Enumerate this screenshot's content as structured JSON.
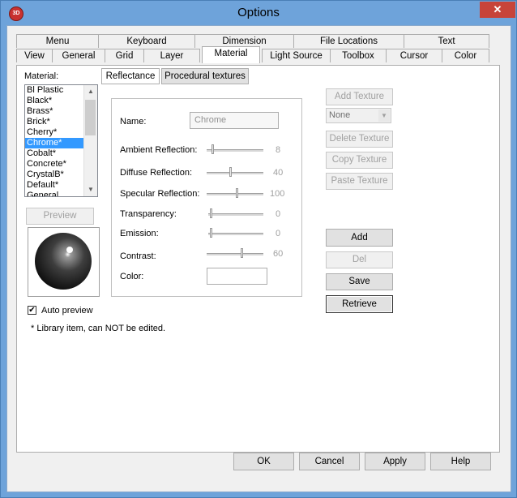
{
  "window": {
    "title": "Options",
    "close_glyph": "✕",
    "app_icon_text": "3D"
  },
  "tabs_row1": [
    "Menu",
    "Keyboard",
    "Dimension",
    "File Locations",
    "Text"
  ],
  "tabs_row2": [
    "View",
    "General",
    "Grid",
    "Layer",
    "Material",
    "Light Source",
    "Toolbox",
    "Cursor",
    "Color"
  ],
  "active_tab": "Material",
  "material": {
    "list_label": "Material:",
    "items": [
      "Bl Plastic",
      "Black*",
      "Brass*",
      "Brick*",
      "Cherry*",
      "Chrome*",
      "Cobalt*",
      "Concrete*",
      "CrystalB*",
      "Default*",
      "General"
    ],
    "selected": "Chrome*",
    "preview_button": "Preview",
    "auto_preview_label": "Auto preview",
    "auto_preview_checked": "✔",
    "library_note": "* Library item, can NOT be edited."
  },
  "subtabs": [
    "Reflectance",
    "Procedural textures"
  ],
  "props": {
    "name_label": "Name:",
    "name_value": "Chrome",
    "ambient_label": "Ambient Reflection:",
    "ambient_value": "8",
    "diffuse_label": "Diffuse Reflection:",
    "diffuse_value": "40",
    "specular_label": "Specular Reflection:",
    "specular_value": "100",
    "transparency_label": "Transparency:",
    "transparency_value": "0",
    "emission_label": "Emission:",
    "emission_value": "0",
    "contrast_label": "Contrast:",
    "contrast_value": "60",
    "color_label": "Color:",
    "color_hex": "#ffffff"
  },
  "texture_buttons": {
    "add_texture": "Add Texture",
    "texture_select": "None",
    "delete_texture": "Delete Texture",
    "copy_texture": "Copy Texture",
    "paste_texture": "Paste Texture"
  },
  "library_buttons": {
    "add": "Add",
    "del": "Del",
    "save": "Save",
    "retrieve": "Retrieve"
  },
  "footer": {
    "ok": "OK",
    "cancel": "Cancel",
    "apply": "Apply",
    "help": "Help"
  }
}
